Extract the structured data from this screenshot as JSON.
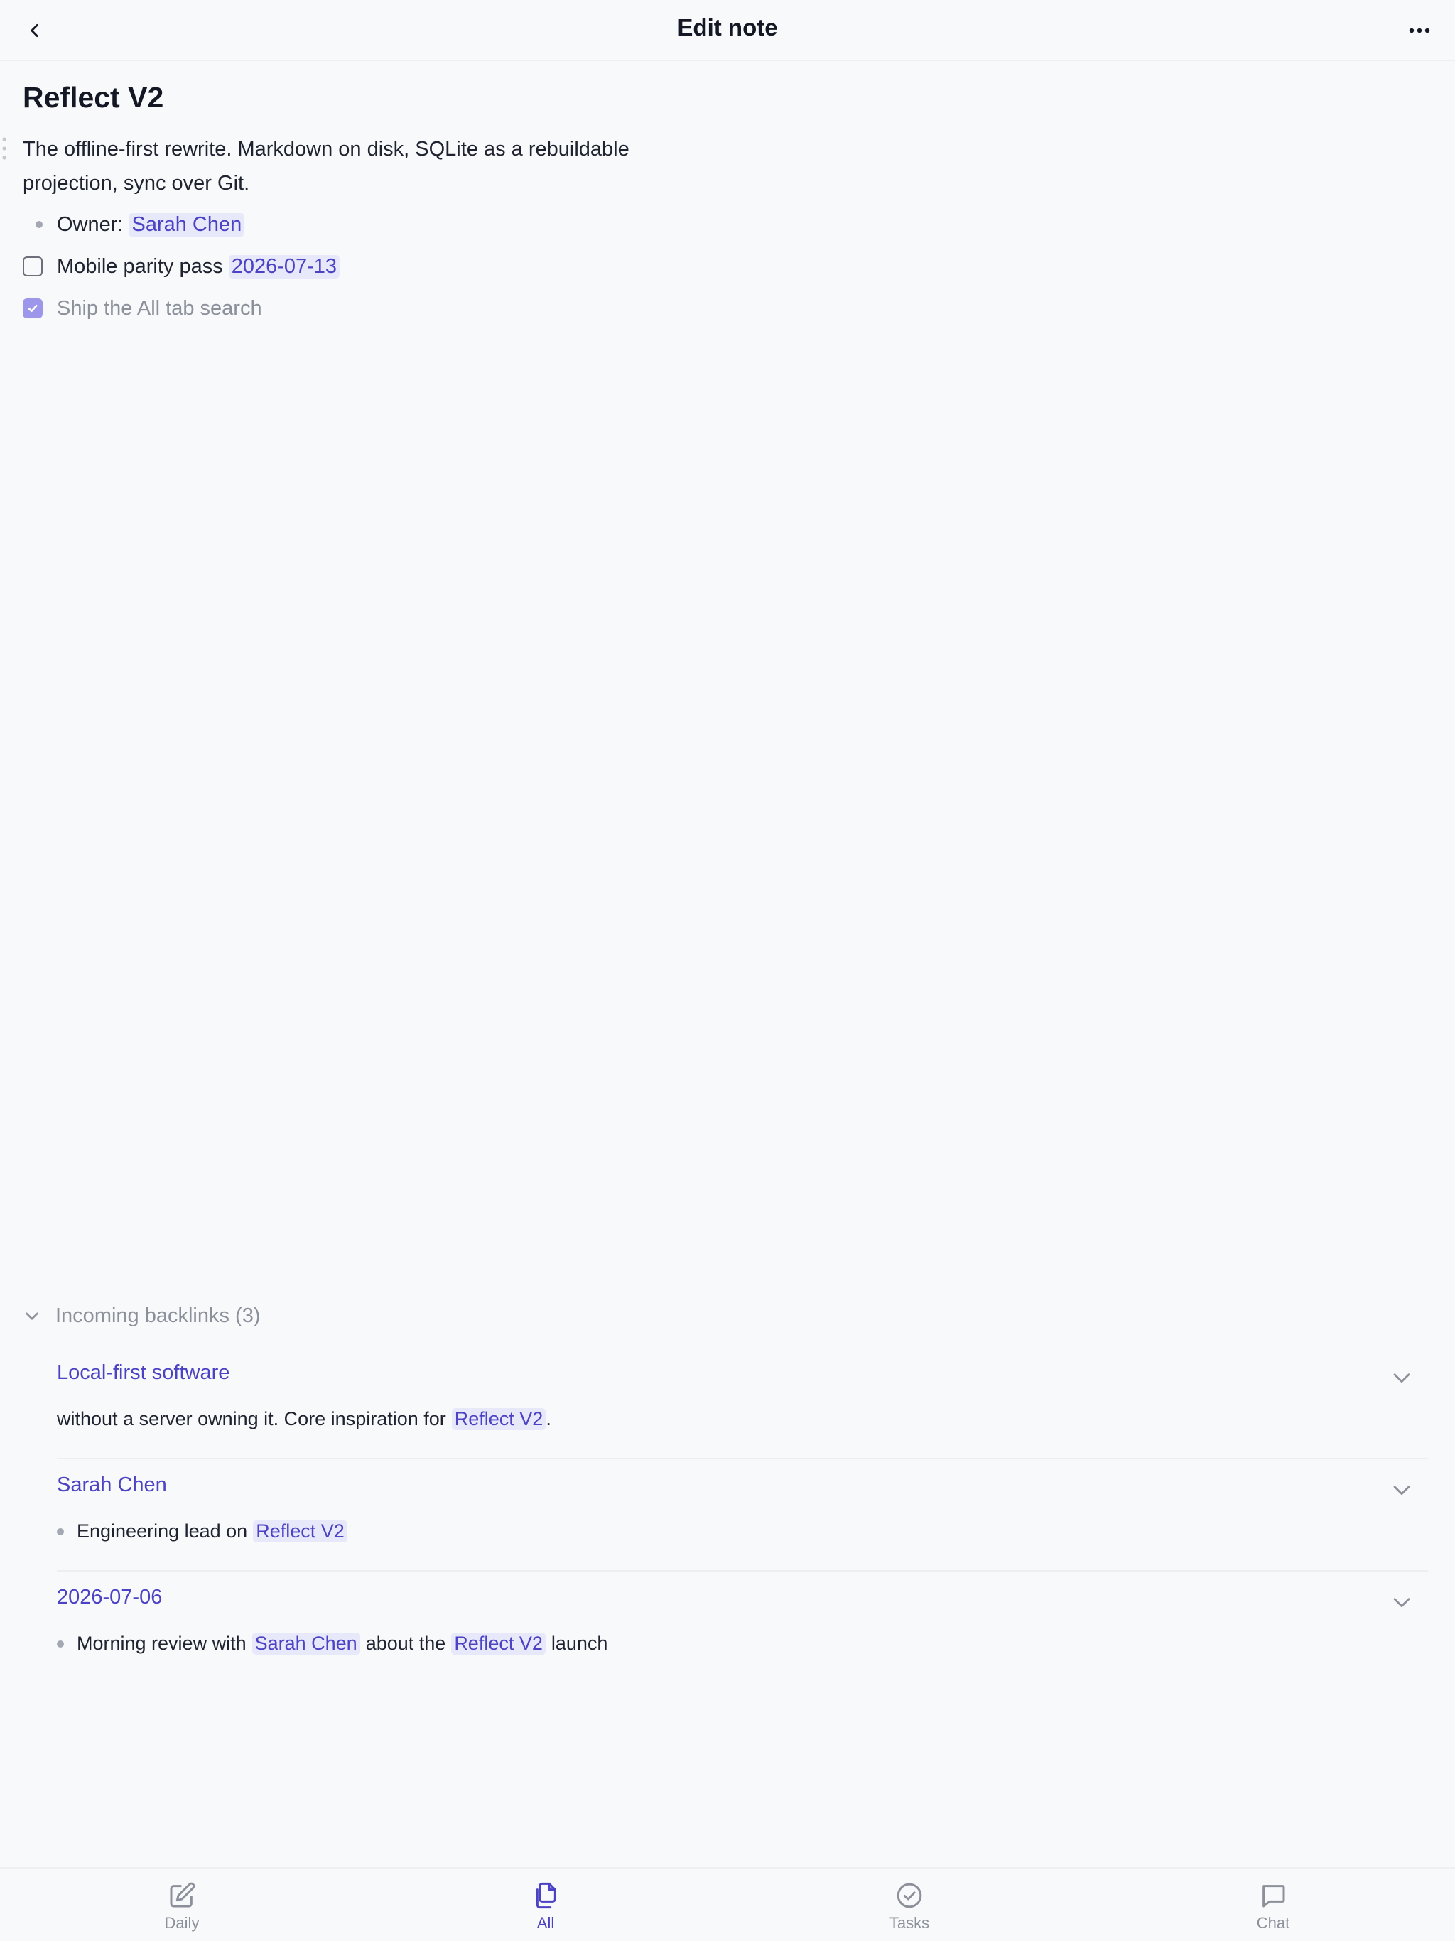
{
  "header": {
    "title": "Edit note",
    "back_icon": "chevron-left-icon",
    "more_icon": "more-horizontal-icon"
  },
  "note": {
    "title": "Reflect V2",
    "paragraph": "The offline-first rewrite. Markdown on disk, SQLite as a rebuildable projection, sync over Git.",
    "owner_label": "Owner:",
    "owner_link": "Sarah Chen",
    "task1_text": "Mobile parity pass",
    "task1_date": "2026-07-13",
    "task1_done": false,
    "task2_text": "Ship the All tab search",
    "task2_done": true
  },
  "backlinks": {
    "header": "Incoming backlinks (3)",
    "items": [
      {
        "title": "Local-first software",
        "snippet_before": "without a server owning it. Core inspiration for",
        "snippet_link": "Reflect V2",
        "snippet_after": "."
      },
      {
        "title": "Sarah Chen",
        "snippet_before": "Engineering lead on",
        "snippet_link": "Reflect V2"
      },
      {
        "title": "2026-07-06",
        "snippet_before": "Morning review with",
        "snippet_link1": "Sarah Chen",
        "snippet_middle": "about the",
        "snippet_link2": "Reflect V2",
        "snippet_after": "launch"
      }
    ]
  },
  "tabbar": {
    "tabs": [
      {
        "label": "Daily",
        "icon": "edit-icon",
        "active": false
      },
      {
        "label": "All",
        "icon": "files-icon",
        "active": true
      },
      {
        "label": "Tasks",
        "icon": "check-circle-icon",
        "active": false
      },
      {
        "label": "Chat",
        "icon": "chat-icon",
        "active": false
      }
    ]
  },
  "colors": {
    "accent": "#4b42c4",
    "chip_bg": "#e8e8fb",
    "muted": "#8c909a",
    "background": "#f8f9fa"
  }
}
